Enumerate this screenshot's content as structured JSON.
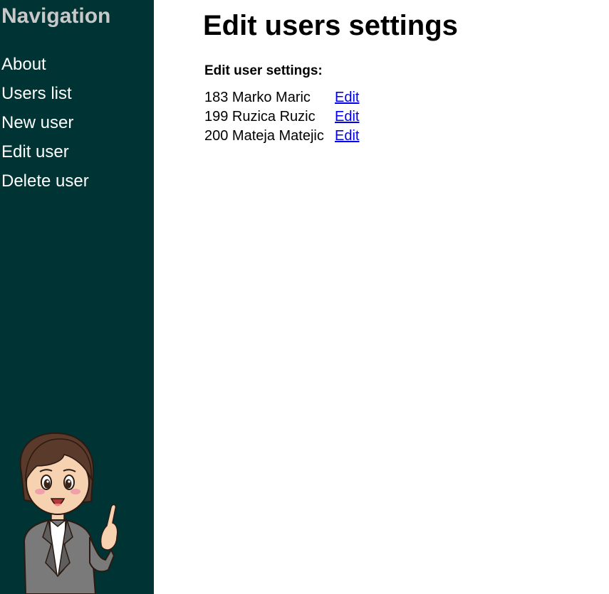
{
  "sidebar": {
    "title": "Navigation",
    "items": [
      {
        "label": "About"
      },
      {
        "label": "Users list"
      },
      {
        "label": "New user"
      },
      {
        "label": "Edit user"
      },
      {
        "label": "Delete user"
      }
    ],
    "background_color": "#003333"
  },
  "main": {
    "title": "Edit users settings",
    "section_heading": "Edit user settings:",
    "users": [
      {
        "id": "183",
        "name": "Marko Maric",
        "display": "183 Marko Maric",
        "action": "Edit"
      },
      {
        "id": "199",
        "name": "Ruzica Ruzic",
        "display": "199 Ruzica Ruzic",
        "action": "Edit"
      },
      {
        "id": "200",
        "name": "Mateja Matejic",
        "display": "200 Mateja Matejic",
        "action": "Edit"
      }
    ],
    "link_color": "#0000ee"
  },
  "mascot": {
    "icon": "pointing-woman-mascot-illustration"
  }
}
